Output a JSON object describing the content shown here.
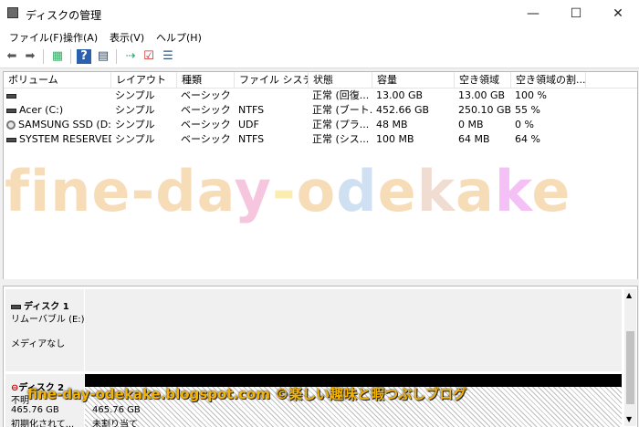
{
  "window": {
    "title": "ディスクの管理",
    "minimize": "—",
    "maximize": "☐",
    "close": "✕"
  },
  "menu": [
    "ファイル(F)",
    "操作(A)",
    "表示(V)",
    "ヘルプ(H)"
  ],
  "toolbar": {
    "icons": [
      "back-arrow-icon",
      "forward-arrow-icon",
      "properties-icon",
      "help-icon",
      "console-icon",
      "rescan-icon",
      "check-icon",
      "list-icon"
    ]
  },
  "volumes": {
    "columns": [
      "ボリューム",
      "レイアウト",
      "種類",
      "ファイル システム",
      "状態",
      "容量",
      "空き領域",
      "空き領域の割..."
    ],
    "rows": [
      {
        "name": "",
        "layout": "シンプル",
        "type": "ベーシック",
        "fs": "",
        "status": "正常 (回復...",
        "capacity": "13.00 GB",
        "free": "13.00 GB",
        "pct": "100 %",
        "icon": "volume-icon"
      },
      {
        "name": "Acer (C:)",
        "layout": "シンプル",
        "type": "ベーシック",
        "fs": "NTFS",
        "status": "正常 (ブート...",
        "capacity": "452.66 GB",
        "free": "250.10 GB",
        "pct": "55 %",
        "icon": "volume-icon"
      },
      {
        "name": "SAMSUNG SSD (D:)",
        "layout": "シンプル",
        "type": "ベーシック",
        "fs": "UDF",
        "status": "正常 (プラ...",
        "capacity": "48 MB",
        "free": "0 MB",
        "pct": "0 %",
        "icon": "disc-icon"
      },
      {
        "name": "SYSTEM RESERVED",
        "layout": "シンプル",
        "type": "ベーシック",
        "fs": "NTFS",
        "status": "正常 (シス...",
        "capacity": "100 MB",
        "free": "64 MB",
        "pct": "64 %",
        "icon": "volume-icon"
      }
    ]
  },
  "watermark": {
    "big": "fine-day-odekake",
    "colors": [
      "#f7dcb8",
      "#f7dcb8",
      "#f7dcb8",
      "#f7dcb8",
      "#f7dcb8",
      "#f7dcb8",
      "#f7dcb8",
      "#f5c6de",
      "#fbecb0",
      "#f7dcb8",
      "#cfe0f2",
      "#f7dcb8",
      "#f0dcd0",
      "#f7dcb8",
      "#f5c0f5",
      "#f7dcb8"
    ],
    "caption": "fine-day-odekake.blogspot.com ©楽しい趣味と暇つぶしブログ"
  },
  "disks": [
    {
      "name": "ディスク 1",
      "kind": "リムーバブル (E:)",
      "media": "メディアなし"
    },
    {
      "name": "ディスク 2",
      "status": "不明",
      "size": "465.76 GB",
      "init": "初期化されて...",
      "part_size": "465.76 GB",
      "part_state": "未割り当て"
    }
  ]
}
